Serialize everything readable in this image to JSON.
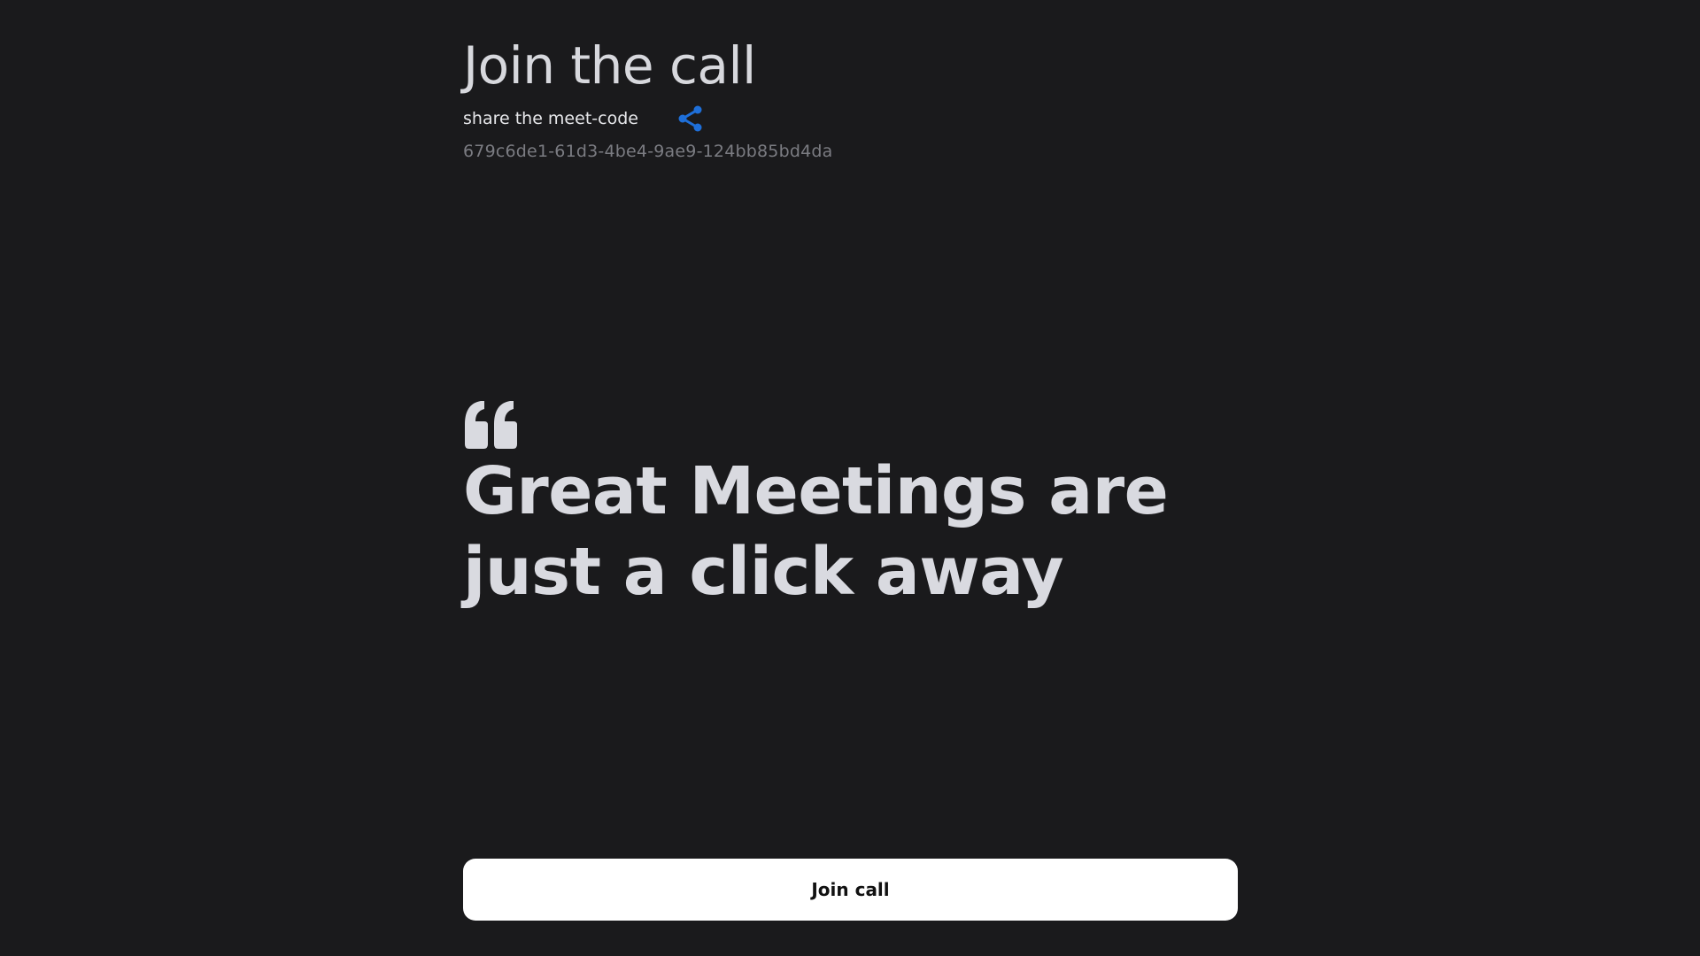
{
  "header": {
    "title": "Join the call",
    "share_label": "share the meet-code",
    "meet_code": "679c6de1-61d3-4be4-9ae9-124bb85bd4da"
  },
  "hero": {
    "tagline": "Great Meetings are just a click away"
  },
  "actions": {
    "join_label": "Join call"
  },
  "icons": {
    "share": "share-icon",
    "quote": "quote-icon"
  },
  "colors": {
    "background": "#1a1a1c",
    "accent": "#1e6fd9",
    "text_primary": "#d9dae0",
    "text_muted": "#7b7c82",
    "button_bg": "#ffffff"
  }
}
